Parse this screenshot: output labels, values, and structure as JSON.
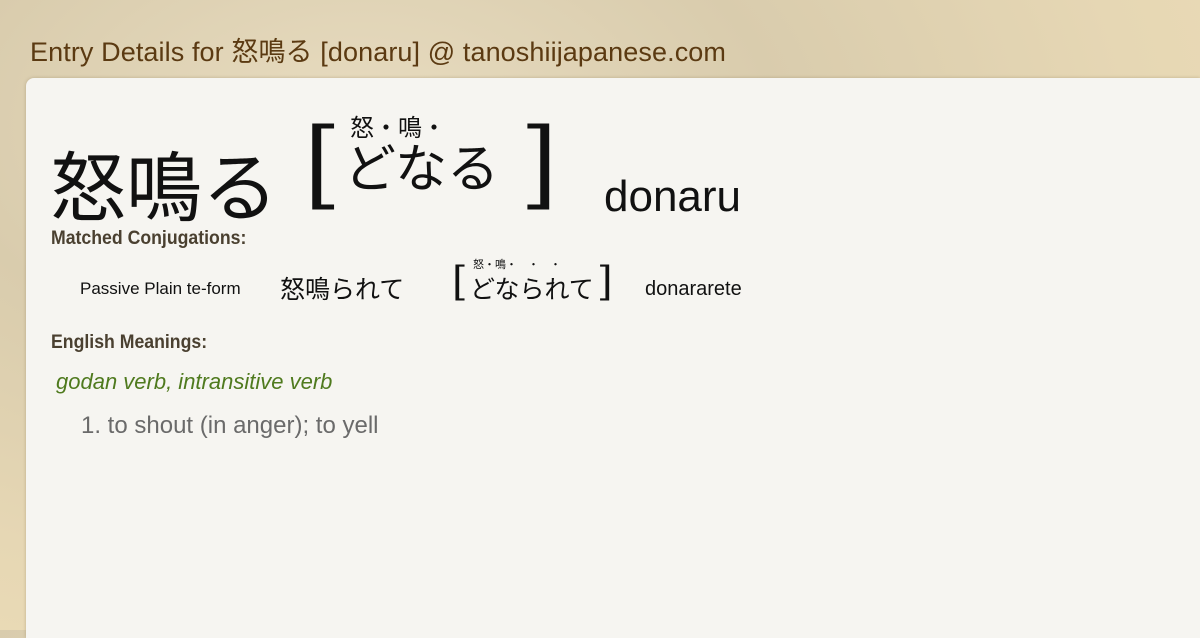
{
  "page": {
    "title": "Entry Details for 怒鳴る [donaru] @ tanoshiijapanese.com"
  },
  "entry": {
    "kanji": "怒鳴る",
    "bracket_open": "[",
    "bracket_close": "]",
    "furigana": "怒・鳴・",
    "kana": "どなる",
    "romaji": "donaru"
  },
  "conjugations": {
    "label": "Matched Conjugations:",
    "items": [
      {
        "form": "Passive Plain te-form",
        "kanji": "怒鳴られて",
        "furigana": "怒・鳴・　・　・",
        "kana": "どなられて",
        "romaji": "donararete"
      }
    ]
  },
  "meanings": {
    "label": "English Meanings:",
    "part_of_speech": "godan verb, intransitive verb",
    "senses": [
      "1. to shout (in anger); to yell"
    ]
  },
  "colors": {
    "title": "#5b3a12",
    "part_of_speech": "#4f7a1e",
    "meaning": "#6a6a6a",
    "card": "#f6f5f1"
  }
}
